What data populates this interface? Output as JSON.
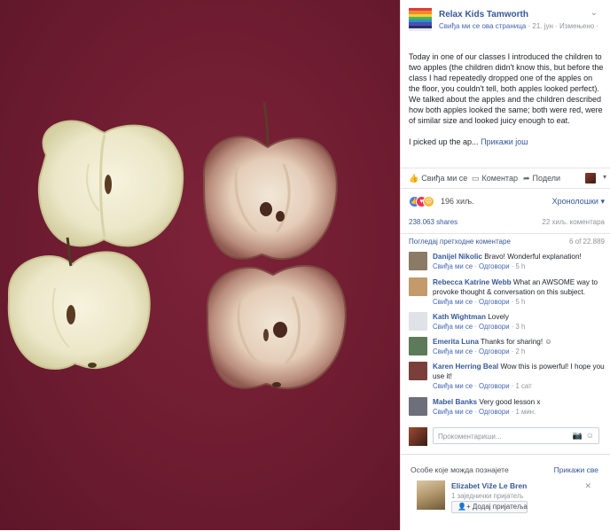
{
  "page": {
    "name": "Relax Kids Tamworth",
    "like_page": "Свиђа ми се ова страница",
    "date": "· 21. јун · Измењено ·"
  },
  "post": {
    "paragraph_1": "Today in one of our classes I introduced the children to two apples (the children didn't know this, but before the class I had repeatedly dropped one of the apples on the floor, you couldn't tell, both apples looked perfect). We talked about the apples and the children described how both apples looked the same; both were red, were of similar size and looked juicy enough to eat.",
    "paragraph_2": "I picked up the ap...",
    "see_more": "Прикажи још"
  },
  "actions": {
    "like": "Свиђа ми се",
    "comment": "Коментар",
    "share": "Подели"
  },
  "reactions": {
    "count": "196 хиљ.",
    "order": "Хронолошки"
  },
  "stats": {
    "shares": "238.063 shares",
    "comments": "22 хиљ. коментара"
  },
  "prev_comments": {
    "link": "Погледај претходне коментаре",
    "count": "6 of 22.889"
  },
  "comments": [
    {
      "name": "Danijel Nikolic",
      "text": "Bravo! Wonderful explanation!",
      "like": "Свиђа ми се",
      "reply": "Одговори",
      "time": "5 h",
      "avatar": "#8a7a66"
    },
    {
      "name": "Rebecca Katrine Webb",
      "text": "What an AWSOME way to provoke thought & conversation on this subject.",
      "like": "Свиђа ми се",
      "reply": "Одговори",
      "time": "5 h",
      "avatar": "#c29a6b"
    },
    {
      "name": "Kath Wightman",
      "text": "Lovely",
      "like": "Свиђа ми се",
      "reply": "Одговори",
      "time": "3 h",
      "avatar": "#dfe3e8"
    },
    {
      "name": "Emerita Luna",
      "text": "Thanks for sharing! ☺",
      "like": "Свиђа ми се",
      "reply": "Одговори",
      "time": "2 h",
      "avatar": "#5d7a5a"
    },
    {
      "name": "Karen Herring Beal",
      "text": "Wow this is powerful! I hope you use it!",
      "like": "Свиђа ми се",
      "reply": "Одговори",
      "time": "1 сат",
      "avatar": "#7a3f3a"
    },
    {
      "name": "Mabel Banks",
      "text": "Very good lesson x",
      "like": "Свиђа ми се",
      "reply": "Одговори",
      "time": "1 мин.",
      "avatar": "#6d6f7a"
    }
  ],
  "compose": {
    "placeholder": "Прокоментариши..."
  },
  "pymk": {
    "title": "Особе које можда познајете",
    "see_all": "Прикажи све",
    "person_name": "Elizabet Viže Le Bren",
    "mutual": "1 заједнички пријатељ",
    "add_friend": "Додај пријатеља"
  },
  "colors": {
    "link": "#365899",
    "photo_background": "#6e1c31"
  },
  "icons": [
    "like-icon",
    "comment-icon",
    "share-icon",
    "camera-icon",
    "smiley-icon",
    "close-icon",
    "chevron-down-icon",
    "add-friend-icon"
  ]
}
